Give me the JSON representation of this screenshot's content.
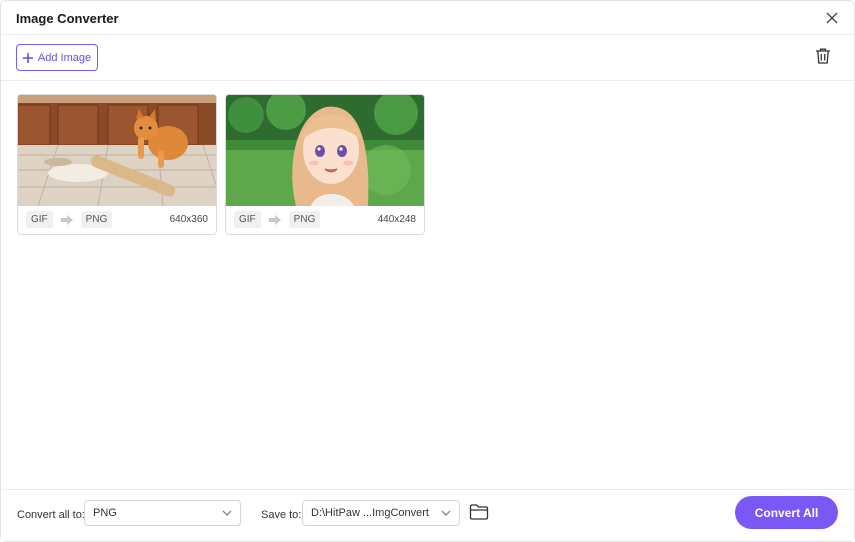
{
  "window": {
    "title": "Image Converter"
  },
  "toolbar": {
    "add_label": "Add Image"
  },
  "images": [
    {
      "from": "GIF",
      "to": "PNG",
      "size": "640x360"
    },
    {
      "from": "GIF",
      "to": "PNG",
      "size": "440x248"
    }
  ],
  "footer": {
    "convert_label": "Convert all to:",
    "convert_value": "PNG",
    "save_label": "Save to:",
    "save_value": "D:\\HitPaw ...ImgConvert",
    "convert_all": "Convert All"
  },
  "colors": {
    "accent": "#7b57f5",
    "accent_text": "#6a4ce6"
  },
  "icons": [
    "close-icon",
    "plus-icon",
    "trash-icon",
    "arrow-right-icon",
    "chevron-down-icon",
    "folder-icon"
  ]
}
